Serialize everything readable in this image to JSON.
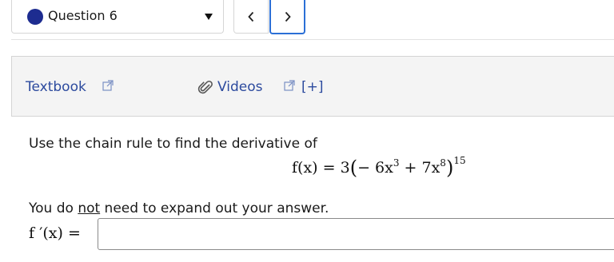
{
  "nav": {
    "question_label": "Question 6",
    "prev_glyph": "<",
    "next_glyph": ">"
  },
  "resources": {
    "textbook_label": "Textbook",
    "videos_label": "Videos",
    "expand_label": "[+]"
  },
  "problem": {
    "instruction_1": "Use the chain rule to find the derivative of",
    "instruction_2_pre": "You do ",
    "instruction_2_emph": "not",
    "instruction_2_post": " need to expand out your answer.",
    "formula": {
      "lhs": "f(x)",
      "equals": "=",
      "coefficient": "3",
      "term1": "− 6x",
      "term1_exp": "3",
      "plus": "+",
      "term2": "7x",
      "term2_exp": "8",
      "outer_exp": "15"
    },
    "answer_label": "f ′(x) =",
    "answer_value": ""
  },
  "colors": {
    "accent": "#2b6fd6",
    "question_dot": "#1d2c90",
    "link": "#2c4a9e",
    "panel_bg": "#f4f4f4"
  },
  "icons": [
    "chevron-left-icon",
    "chevron-right-icon",
    "external-link-icon",
    "paperclip-icon",
    "caret-down-icon"
  ]
}
